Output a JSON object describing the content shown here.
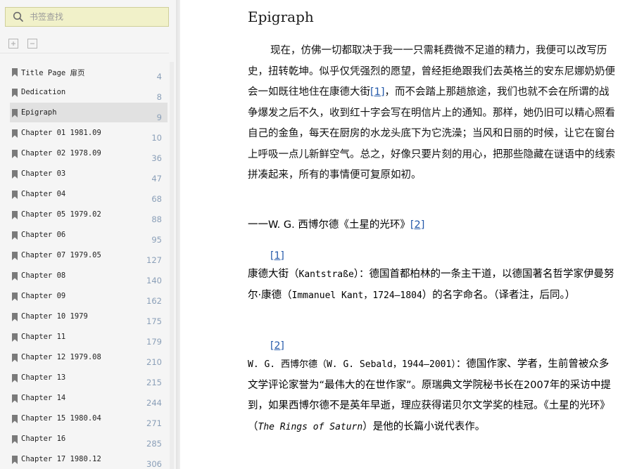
{
  "search": {
    "placeholder": "书签查找"
  },
  "toc": [
    {
      "label": "Title Page 扉页",
      "page": "4"
    },
    {
      "label": "Dedication",
      "page": "8"
    },
    {
      "label": "Epigraph",
      "page": "9",
      "active": true
    },
    {
      "label": "Chapter 01 1981.09",
      "page": "10"
    },
    {
      "label": "Chapter 02 1978.09",
      "page": "36"
    },
    {
      "label": "Chapter 03",
      "page": "47"
    },
    {
      "label": "Chapter 04",
      "page": "68"
    },
    {
      "label": "Chapter 05 1979.02",
      "page": "88"
    },
    {
      "label": "Chapter 06",
      "page": "95"
    },
    {
      "label": "Chapter 07 1979.05",
      "page": "127"
    },
    {
      "label": "Chapter 08",
      "page": "140"
    },
    {
      "label": "Chapter 09",
      "page": "162"
    },
    {
      "label": "Chapter 10 1979",
      "page": "175"
    },
    {
      "label": "Chapter 11",
      "page": "179"
    },
    {
      "label": "Chapter 12 1979.08",
      "page": "210"
    },
    {
      "label": "Chapter 13",
      "page": "215"
    },
    {
      "label": "Chapter 14",
      "page": "244"
    },
    {
      "label": "Chapter 15 1980.04",
      "page": "271"
    },
    {
      "label": "Chapter 16",
      "page": "285"
    },
    {
      "label": "Chapter 17 1980.12",
      "page": "306"
    }
  ],
  "content": {
    "title": "Epigraph",
    "para_part1": "现在，仿佛一切都取决于我一一只需耗费微不足道的精力，我便可以改写历史，扭转乾坤。似乎仅凭强烈的愿望，曾经拒绝跟我们去英格兰的安东尼娜奶奶便会一如既往地住在康德大街",
    "para_ref": "[1]",
    "para_part2": "，而不会踏上那趟旅途，我们也就不会在所谓的战争爆发之后不久，收到红十字会写在明信片上的通知。那样，她仍旧可以精心照看自己的金鱼，每天在厨房的水龙头底下为它洗澡；当风和日丽的时候，让它在窗台上呼吸一点儿新鲜空气。总之，好像只要片刻的用心，把那些隐藏在谜语中的线索拼凑起来，所有的事情便可复原如初。",
    "attribution": "一一W. G. 西博尔德《土星的光环》",
    "attribution_ref": "[2]",
    "note1_ref": "[1]",
    "note1_a": "康德大街（",
    "note1_b": "Kantstraße",
    "note1_c": "）：德国首都柏林的一条主干道，以德国著名哲学家伊曼努尔·康德（",
    "note1_d": "Immanuel Kant，1724—1804",
    "note1_e": "）的名字命名。（译者注，后同。）",
    "note2_ref": "[2]",
    "note2_a": "W. G. 西博尔德（W. G. Sebald，1944—2001）",
    "note2_b": "：德国作家、学者，生前曾被众多文学评论家誉为“最伟大的在世作家”。原瑞典文学院秘书长在2007年的采访中提到，如果西博尔德不是英年早逝，理应获得诺贝尔文学奖的桂冠。《土星的光环》（",
    "note2_c": "The Rings of Saturn",
    "note2_d": "）是他的长篇小说代表作。"
  }
}
